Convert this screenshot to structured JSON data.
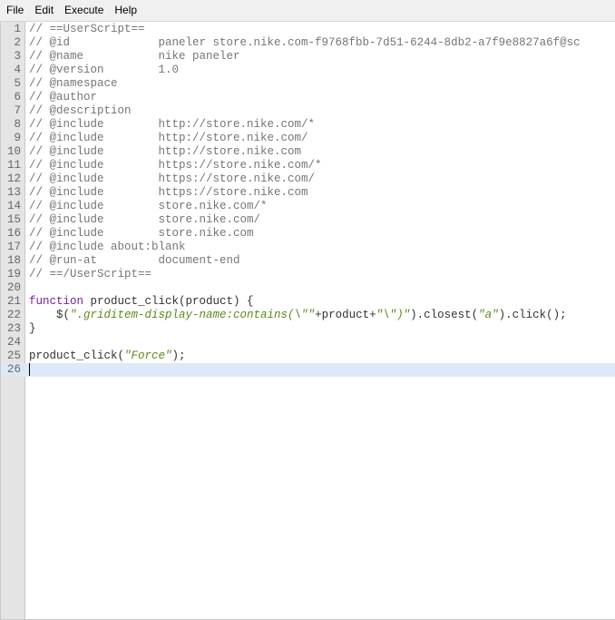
{
  "menu": {
    "items": [
      "File",
      "Edit",
      "Execute",
      "Help"
    ]
  },
  "editor": {
    "active_line": 26,
    "lines": [
      {
        "n": "1",
        "t": "// ==UserScript=="
      },
      {
        "n": "2",
        "t": "// @id             paneler store.nike.com-f9768fbb-7d51-6244-8db2-a7f9e8827a6f@sc"
      },
      {
        "n": "3",
        "t": "// @name           nike paneler"
      },
      {
        "n": "4",
        "t": "// @version        1.0"
      },
      {
        "n": "5",
        "t": "// @namespace"
      },
      {
        "n": "6",
        "t": "// @author"
      },
      {
        "n": "7",
        "t": "// @description"
      },
      {
        "n": "8",
        "t": "// @include        http://store.nike.com/*"
      },
      {
        "n": "9",
        "t": "// @include        http://store.nike.com/"
      },
      {
        "n": "10",
        "t": "// @include        http://store.nike.com"
      },
      {
        "n": "11",
        "t": "// @include        https://store.nike.com/*"
      },
      {
        "n": "12",
        "t": "// @include        https://store.nike.com/"
      },
      {
        "n": "13",
        "t": "// @include        https://store.nike.com"
      },
      {
        "n": "14",
        "t": "// @include        store.nike.com/*"
      },
      {
        "n": "15",
        "t": "// @include        store.nike.com/"
      },
      {
        "n": "16",
        "t": "// @include        store.nike.com"
      },
      {
        "n": "17",
        "t": "// @include about:blank"
      },
      {
        "n": "18",
        "t": "// @run-at         document-end"
      },
      {
        "n": "19",
        "t": "// ==/UserScript=="
      },
      {
        "n": "20",
        "t": ""
      },
      {
        "n": "21",
        "t": "function product_click(product) {"
      },
      {
        "n": "22",
        "t": "    $(\".griditem-display-name:contains(\\\"\"+product+\"\\\")\").closest(\"a\").click();"
      },
      {
        "n": "23",
        "t": "}"
      },
      {
        "n": "24",
        "t": ""
      },
      {
        "n": "25",
        "t": "product_click(\"Force\");"
      },
      {
        "n": "26",
        "t": ""
      }
    ],
    "line22_parts": {
      "a": "    $(",
      "s1": "\".griditem-display-name:contains(\\\"\"",
      "b": "+product+",
      "s2": "\"\\\")\"",
      "c": ").closest(",
      "s3": "\"a\"",
      "d": ").click();"
    },
    "line21_parts": {
      "kw": "function",
      "rest": " product_click(product) {"
    },
    "line25_parts": {
      "a": "product_click(",
      "s": "\"Force\"",
      "b": ");"
    }
  }
}
